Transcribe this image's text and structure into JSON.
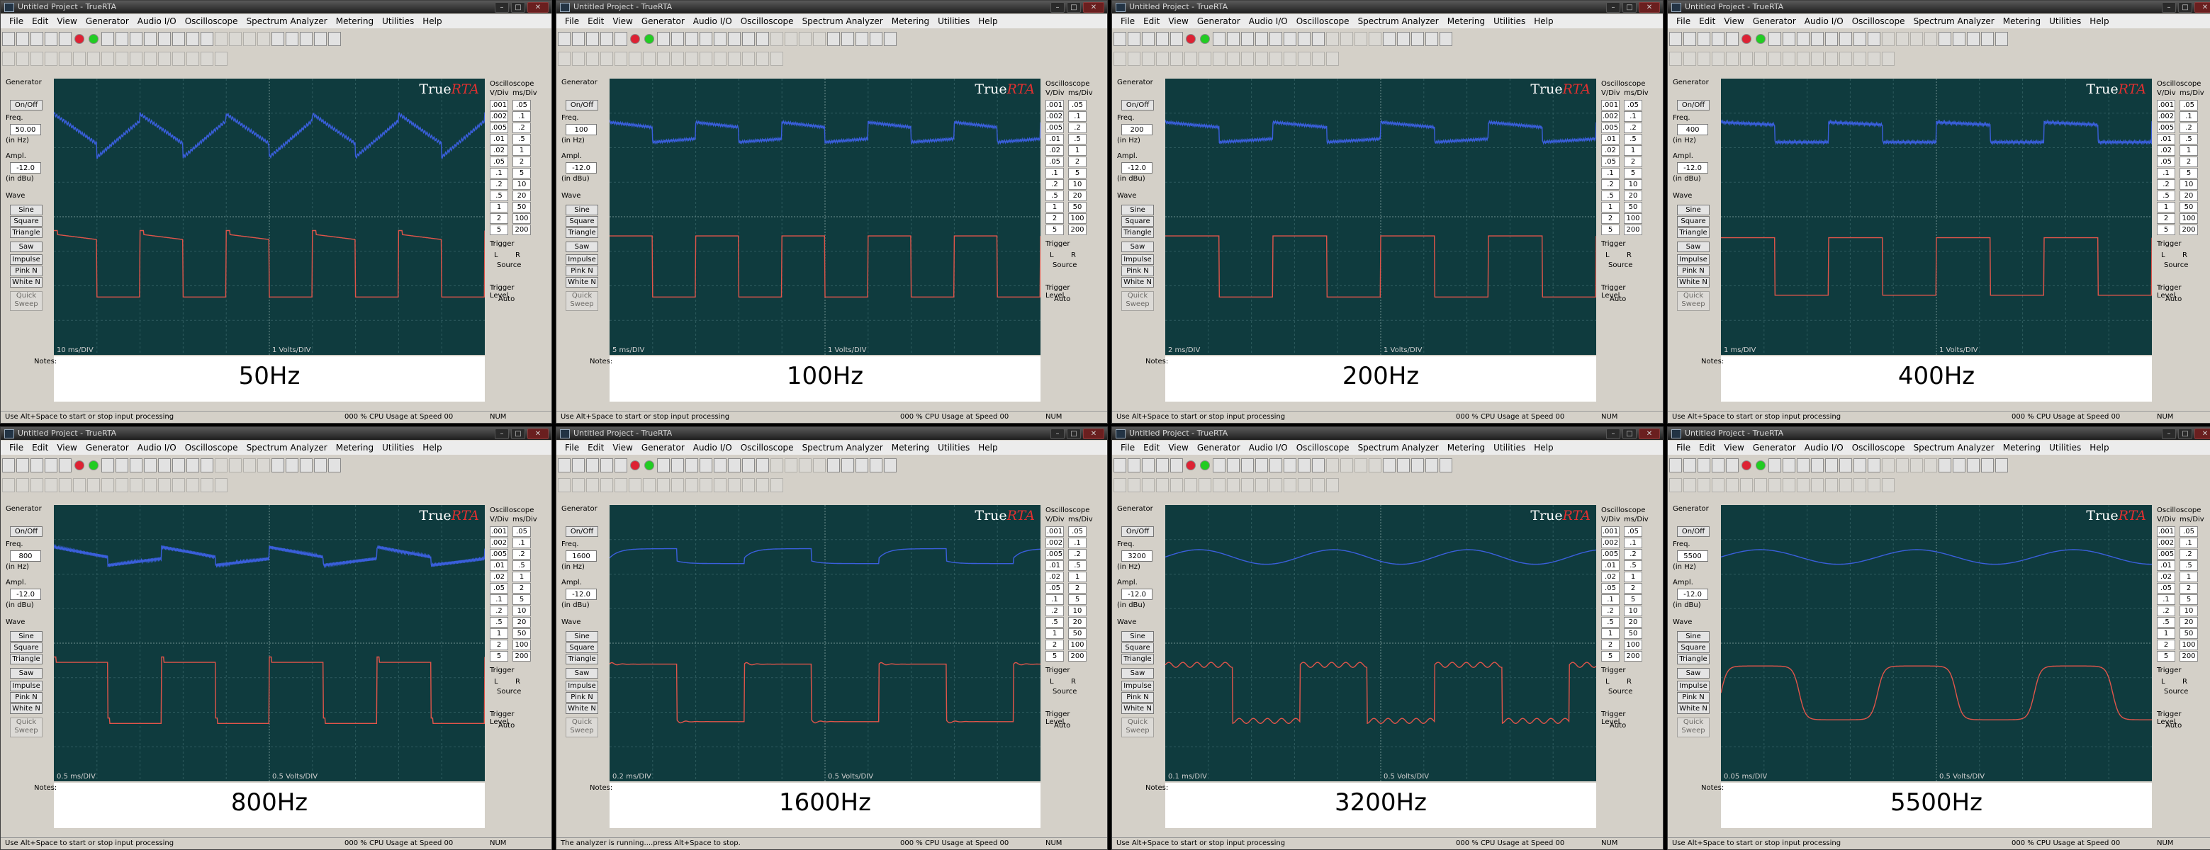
{
  "window_title": "Untitled Project - TrueRTA",
  "window_controls": [
    "–",
    "□",
    "✕"
  ],
  "menu": [
    "File",
    "Edit",
    "View",
    "Generator",
    "Audio I/O",
    "Oscilloscope",
    "Spectrum Analyzer",
    "Metering",
    "Utilities",
    "Help"
  ],
  "logo": {
    "true": "True",
    "rta": "RTA"
  },
  "generator": {
    "title": "Generator",
    "on_off": "On/Off",
    "freq_label": "Freq.",
    "freq_unit": "(in Hz)",
    "ampl_label": "Ampl.",
    "ampl_unit": "(in dBu)",
    "wave_label": "Wave",
    "waves": [
      "Sine",
      "Square",
      "Triangle"
    ],
    "saw": "Saw",
    "noises": [
      "Impulse",
      "Pink N",
      "White N"
    ],
    "quick_sweep": "Quick Sweep"
  },
  "oscilloscope": {
    "title": "Oscilloscope",
    "vdiv_label": "V/Div",
    "msdiv_label": "ms/Div",
    "vdiv_values": [
      ".001",
      ".002",
      ".005",
      ".01",
      ".02",
      ".05",
      ".1",
      ".2",
      ".5",
      "1",
      "2",
      "5"
    ],
    "msdiv_values": [
      ".05",
      ".1",
      ".2",
      ".5",
      "1",
      "2",
      "5",
      "10",
      "20",
      "50",
      "100",
      "200"
    ],
    "trigger": "Trigger",
    "trig_l": "L",
    "trig_r": "R",
    "source": "Source",
    "trigger_level": "Trigger Level",
    "auto": "Auto"
  },
  "notes_label": "Notes:",
  "volts_div": "1 Volts/DIV",
  "volts_div_bottom": "0.5 Volts/DIV",
  "status_right_1": "000 % CPU Usage at Speed 00",
  "status_right_2": "NUM",
  "panels": [
    {
      "caption": "50Hz",
      "freq": "50.00",
      "ampl": "-12.0",
      "ms_div": "10   ms/DIV",
      "status": "Use Alt+Space to start or stop input processing",
      "kind": "saw",
      "cycles": 5.0
    },
    {
      "caption": "100Hz",
      "freq": "100",
      "ampl": "-12.0",
      "ms_div": "5   ms/DIV",
      "status": "Use Alt+Space to start or stop input processing",
      "kind": "square1",
      "cycles": 5.0
    },
    {
      "caption": "200Hz",
      "freq": "200",
      "ampl": "-12.0",
      "ms_div": "2   ms/DIV",
      "status": "Use Alt+Space to start or stop input processing",
      "kind": "square1",
      "cycles": 4.0
    },
    {
      "caption": "400Hz",
      "freq": "400",
      "ampl": "-12.0",
      "ms_div": "1   ms/DIV",
      "status": "Use Alt+Space to start or stop input processing",
      "kind": "square2",
      "cycles": 4.0
    },
    {
      "caption": "800Hz",
      "freq": "800",
      "ampl": "-12.0",
      "ms_div": "0.5   ms/DIV",
      "status": "Use Alt+Space to start or stop input processing",
      "kind": "square3",
      "cycles": 4.0
    },
    {
      "caption": "1600Hz",
      "freq": "1600",
      "ampl": "-12.0",
      "ms_div": "0.2   ms/DIV",
      "status": "The analyzer is running....press Alt+Space to stop.",
      "kind": "square4",
      "cycles": 3.2
    },
    {
      "caption": "3200Hz",
      "freq": "3200",
      "ampl": "-12.0",
      "ms_div": "0.1   ms/DIV",
      "status": "Use Alt+Space to start or stop input processing",
      "kind": "square5",
      "cycles": 3.2
    },
    {
      "caption": "5500Hz",
      "freq": "5500",
      "ampl": "-12.0",
      "ms_div": "0.05   ms/DIV",
      "status": "Use Alt+Space to start or stop input processing",
      "kind": "square6",
      "cycles": 2.75
    }
  ]
}
